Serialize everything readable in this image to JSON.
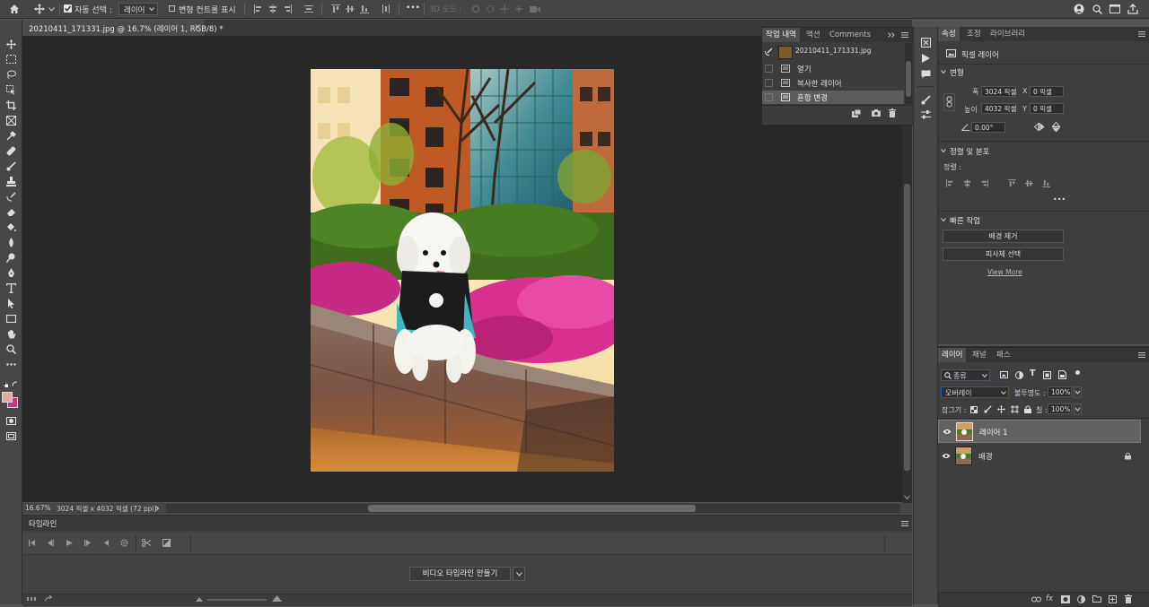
{
  "options_bar": {
    "auto_select_label": "자동 선택 :",
    "auto_select_target": "레이어",
    "transform_controls_label": "변형 컨트롤 표시",
    "more_label": "•••",
    "threed_mode_label": "3D 모드 :"
  },
  "document": {
    "tab_title": "20210411_171331.jpg @ 16.7% (레이어 1, RGB/8) *",
    "close_glyph": "×",
    "zoom": "16.67%",
    "info": "3024 픽셀 x 4032 픽셀 (72 ppi)"
  },
  "history_panel": {
    "tabs": [
      "작업 내역",
      "액션",
      "Comments"
    ],
    "snapshot_label": "20210411_171331.jpg",
    "states": [
      "열기",
      "복사한 레이어",
      "혼합 변경"
    ]
  },
  "timeline": {
    "title": "타임라인",
    "create_button": "비디오 타임라인 만들기"
  },
  "properties_panel": {
    "tabs": [
      "속성",
      "조정",
      "라이브러리"
    ],
    "layer_kind": "픽셀 레이어",
    "transform_header": "변형",
    "width_label": "폭",
    "width_value": "3024 픽셀",
    "height_label": "높이",
    "height_value": "4032 픽셀",
    "x_label": "X",
    "x_value": "0 픽셀",
    "y_label": "Y",
    "y_value": "0 픽셀",
    "angle_value": "0.00°",
    "align_header": "정렬 및 분포",
    "align_label": "정렬 :",
    "ellipsis": "•••",
    "quick_actions_header": "빠른 작업",
    "remove_bg_button": "배경 제거",
    "select_subject_button": "피사체 선택",
    "view_more_link": "View More"
  },
  "layers_panel": {
    "tabs": [
      "레이어",
      "채널",
      "패스"
    ],
    "filter_kind": "종류",
    "blend_mode": "오버레이",
    "opacity_label": "불투명도 :",
    "opacity_value": "100%",
    "lock_label": "잠그기 :",
    "fill_label": "칠 :",
    "fill_value": "100%",
    "layers": [
      {
        "name": "레이어 1",
        "selected": true,
        "locked": false
      },
      {
        "name": "배경",
        "selected": false,
        "locked": true
      }
    ]
  },
  "colors": {
    "foreground": "#e5a7a1",
    "background": "#c23a7a"
  }
}
